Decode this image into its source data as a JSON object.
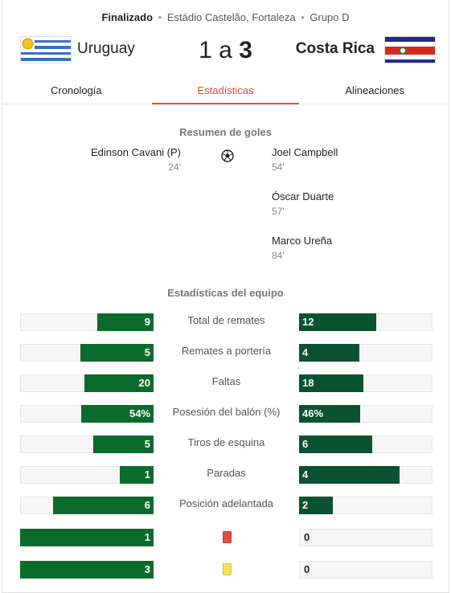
{
  "match": {
    "status": "Finalizado",
    "venue": "Estádio Castelão, Fortaleza",
    "group": "Grupo D",
    "separator": "•",
    "home_team": "Uruguay",
    "away_team": "Costa Rica",
    "home_score": "1",
    "score_joiner": "a",
    "away_score": "3"
  },
  "tabs": [
    {
      "label": "Cronología",
      "active": false
    },
    {
      "label": "Estadísticas",
      "active": true
    },
    {
      "label": "Alineaciones",
      "active": false
    }
  ],
  "goals": {
    "title": "Resumen de goles",
    "home": [
      {
        "player": "Edinson Cavani (P)",
        "minute": "24'"
      }
    ],
    "away": [
      {
        "player": "Joel Campbell",
        "minute": "54'"
      },
      {
        "player": "Óscar Duarte",
        "minute": "57'"
      },
      {
        "player": "Marco Ureña",
        "minute": "84'"
      }
    ]
  },
  "team_stats": {
    "title": "Estadísticas del equipo",
    "rows": [
      {
        "label": "Total de remates",
        "home": "9",
        "away": "12",
        "home_fill": 0.42,
        "away_fill": 0.58
      },
      {
        "label": "Remates a portería",
        "home": "5",
        "away": "4",
        "home_fill": 0.55,
        "away_fill": 0.45
      },
      {
        "label": "Faltas",
        "home": "20",
        "away": "18",
        "home_fill": 0.52,
        "away_fill": 0.48
      },
      {
        "label": "Posesión del balón (%)",
        "home": "54%",
        "away": "46%",
        "home_fill": 0.54,
        "away_fill": 0.46
      },
      {
        "label": "Tiros de esquina",
        "home": "5",
        "away": "6",
        "home_fill": 0.45,
        "away_fill": 0.55
      },
      {
        "label": "Paradas",
        "home": "1",
        "away": "4",
        "home_fill": 0.25,
        "away_fill": 0.75
      },
      {
        "label": "Posición adelantada",
        "home": "6",
        "away": "2",
        "home_fill": 0.75,
        "away_fill": 0.25
      },
      {
        "label": "",
        "icon": "red-card-icon",
        "home": "1",
        "away": "0",
        "home_fill": 1.0,
        "away_fill": 0.0
      },
      {
        "label": "",
        "icon": "yellow-card-icon",
        "home": "3",
        "away": "0",
        "home_fill": 1.0,
        "away_fill": 0.0
      }
    ]
  },
  "colors": {
    "accent": "#dd4b39",
    "home_bar": "#0b6b2b",
    "away_bar": "#0a5230"
  }
}
